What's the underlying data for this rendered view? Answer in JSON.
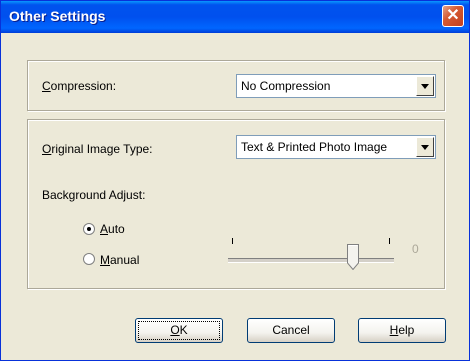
{
  "window": {
    "title": "Other Settings",
    "close_glyph": "✕"
  },
  "compression": {
    "label_mnemonic": "C",
    "label_rest": "ompression:",
    "value": "No Compression"
  },
  "image_type": {
    "label_mnemonic": "O",
    "label_rest": "riginal Image Type:",
    "value": "Text & Printed Photo Image"
  },
  "background_adjust": {
    "label": "Background Adjust:",
    "options": [
      {
        "mnemonic": "A",
        "rest": "uto",
        "checked": true
      },
      {
        "mnemonic": "M",
        "rest": "anual",
        "checked": false
      }
    ],
    "slider_value_text": "0",
    "slider_position": 0.75
  },
  "buttons": {
    "ok": {
      "mnemonic": "O",
      "rest": "K"
    },
    "cancel": "Cancel",
    "help": {
      "mnemonic": "H",
      "rest": "elp"
    }
  },
  "colors": {
    "titlebar": "#0053EE",
    "close": "#D65A32",
    "face": "#ECE9D8"
  },
  "icons": {
    "close": "close-icon",
    "dropdown": "chevron-down-icon"
  }
}
